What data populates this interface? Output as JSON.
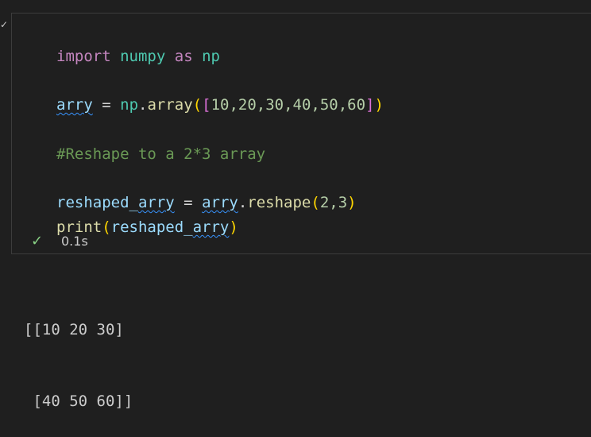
{
  "cell_marker": "✓",
  "editor": {
    "lines": {
      "l1": {
        "t1": "import",
        "t2": "numpy",
        "t3": "as",
        "t4": "np"
      },
      "l2": {
        "t1": "arry",
        "t2": "=",
        "t3": "np",
        "t4": ".",
        "t5": "array",
        "t6": "(",
        "t7": "[",
        "t8": "10,20,30,40,50,60",
        "t9": "]",
        "t10": ")"
      },
      "l3": {
        "t1": "#Reshape to a 2*3 array"
      },
      "l4": {
        "t1": "reshaped_arry",
        "t2": "=",
        "t3": "arry",
        "t4": ".",
        "t5": "reshape",
        "t6": "(",
        "t7": "2,3",
        "t8": ")"
      },
      "l5": {
        "t1": "print",
        "t2": "(",
        "t3": "reshaped_arry",
        "t4": ")"
      }
    }
  },
  "status": {
    "check_icon": "✓",
    "duration": "0.1s"
  },
  "output": {
    "line1": "[[10 20 30]",
    "line2": " [40 50 60]]"
  },
  "colors": {
    "background": "#1f1f1f",
    "keyword": "#c586c0",
    "module": "#4ec9b0",
    "variable": "#9cdcfe",
    "function": "#dcdcaa",
    "number": "#b5cea8",
    "comment": "#6a9955",
    "success": "#89d185"
  }
}
